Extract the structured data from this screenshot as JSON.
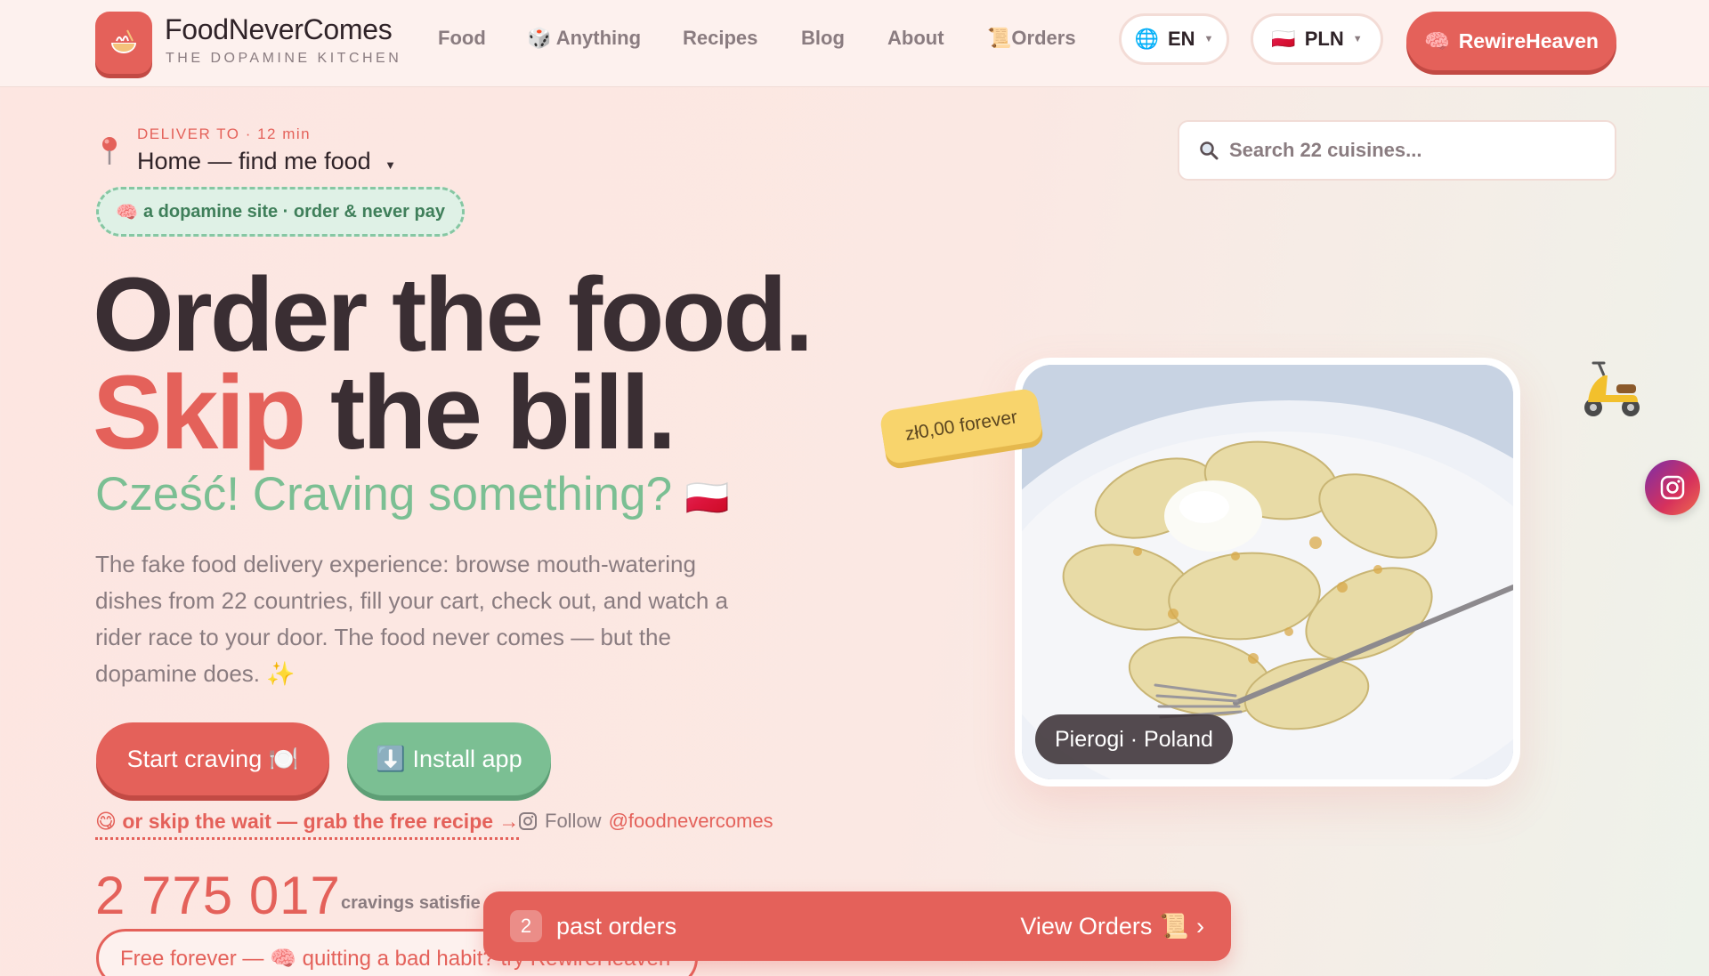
{
  "nav": {
    "brand_name": "FoodNeverComes",
    "brand_tagline": "THE DOPAMINE KITCHEN",
    "logo_icon": "ramen-bowl-icon",
    "links": [
      {
        "label": "Food",
        "icon": ""
      },
      {
        "label": "Anything",
        "icon": "🎲"
      },
      {
        "label": "Recipes",
        "icon": ""
      },
      {
        "label": "Blog",
        "icon": ""
      },
      {
        "label": "About",
        "icon": ""
      },
      {
        "label": "Orders",
        "icon": "📜"
      }
    ],
    "language": {
      "label": "EN",
      "icon": "🌐"
    },
    "currency": {
      "label": "PLN",
      "flag": "🇵🇱"
    },
    "cta": {
      "label": "RewireHeaven",
      "icon": "🧠"
    }
  },
  "deliver": {
    "label": "DELIVER TO · 12 min",
    "address": "Home — find me food"
  },
  "search": {
    "placeholder": "Search 22 cuisines..."
  },
  "hero": {
    "tagline_icon": "🧠",
    "tagline": "a dopamine site · order & never pay",
    "headline_line1": "Order the food.",
    "headline_skip": "Skip",
    "headline_rest": " the bill.",
    "greeting": "Cześć! Craving something?",
    "greeting_flag": "🇵🇱",
    "description": "The fake food delivery experience: browse mouth-watering dishes from 22 countries, fill your cart, check out, and watch a rider race to your door. The food never comes — but the dopamine does. ✨",
    "primary_button": "Start craving 🍽️",
    "secondary_button": "⬇️ Install app",
    "skip_link": "😋 or skip the wait — grab the free recipe →",
    "follow_label": "Follow",
    "follow_handle": "@foodnevercomes",
    "counter_value": "2 775 017",
    "counter_label": "cravings satisfie",
    "free_pill": "Free forever — 🧠 quitting a bad habit? try RewireHeaven"
  },
  "featured": {
    "price_tag": "zł0,00 forever",
    "caption": "Pierogi · Poland"
  },
  "orders_bar": {
    "count": "2",
    "text": "past orders",
    "link_label": "View Orders",
    "link_icon": "📜",
    "chevron": "›"
  },
  "colors": {
    "accent": "#e4615a",
    "green": "#7bbf93",
    "text": "#3a2e33",
    "muted": "#8a7c80"
  }
}
